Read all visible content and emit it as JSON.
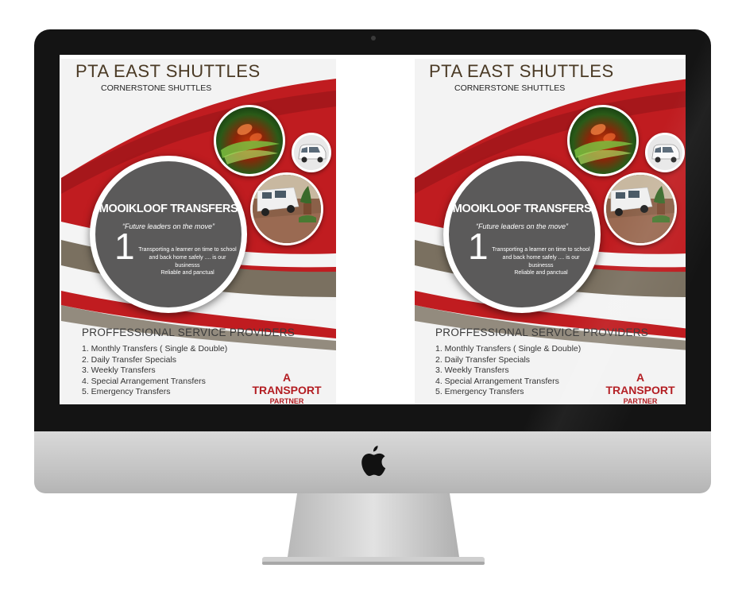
{
  "posters": [
    {
      "title": "PTA EAST SHUTTLES",
      "subtitle": "CORNERSTONE SHUTTLES",
      "circle_title": "MOOIKLOOF TRANSFERS",
      "circle_quote": "“Future leaders on the move”",
      "circle_number": "1",
      "circle_body": "Transporting a learner on time to school and back home safely .... is our businesss",
      "circle_reliable": "Reliable and panctual",
      "services_heading": "PROFFESSIONAL SERVICE PROVIDERS",
      "services": [
        "1. Monthly Transfers ( Single & Double)",
        "2. Daily Transfer Specials",
        "3. Weekly Transfers",
        "4. Special Arrangement Transfers",
        "5. Emergency Transfers"
      ],
      "partner_line1": "A",
      "partner_line2": "TRANSPORT",
      "partner_line3": "PARTNER"
    },
    {
      "title": "PTA EAST SHUTTLES",
      "subtitle": "CORNERSTONE SHUTTLES",
      "circle_title": "MOOIKLOOF TRANSFERS",
      "circle_quote": "“Future leaders on the move”",
      "circle_number": "1",
      "circle_body": "Transporting a learner on time to school and back home safely .... is our businesss",
      "circle_reliable": "Reliable and panctual",
      "services_heading": "PROFFESSIONAL SERVICE PROVIDERS",
      "services": [
        "1. Monthly Transfers ( Single & Double)",
        "2. Daily Transfer Specials",
        "3. Weekly Transfers",
        "4. Special Arrangement Transfers",
        "5. Emergency Transfers"
      ],
      "partner_line1": "A",
      "partner_line2": "TRANSPORT",
      "partner_line3": "PARTNER"
    }
  ],
  "colors": {
    "brand_red": "#b31d22",
    "wave_red": "#c01c20",
    "wave_olive": "#7a7060",
    "circle_grey": "#5b5a5a",
    "monitor_bezel": "#141414"
  },
  "icons": {
    "device_logo": "apple-logo-icon"
  }
}
